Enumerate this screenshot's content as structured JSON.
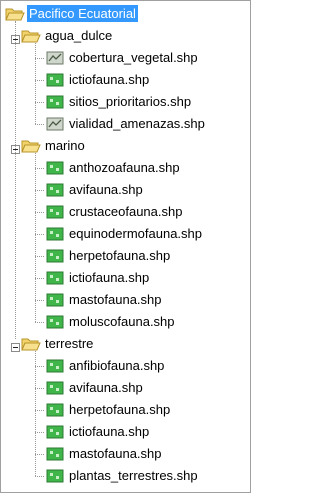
{
  "tree": {
    "root": {
      "label": "Pacifico Ecuatorial",
      "icon": "open-folder-icon",
      "selected": true
    },
    "groups": [
      {
        "name": "agua-dulce",
        "label": "agua_dulce",
        "expand_symbol": "−",
        "items": [
          {
            "label": "cobertura_vegetal.shp",
            "icon": "polyline-layer-icon"
          },
          {
            "label": "ictiofauna.shp",
            "icon": "polygon-layer-icon"
          },
          {
            "label": "sitios_prioritarios.shp",
            "icon": "polygon-layer-icon"
          },
          {
            "label": "vialidad_amenazas.shp",
            "icon": "polyline-layer-icon"
          }
        ]
      },
      {
        "name": "marino",
        "label": "marino",
        "expand_symbol": "−",
        "items": [
          {
            "label": "anthozoafauna.shp",
            "icon": "polygon-layer-icon"
          },
          {
            "label": "avifauna.shp",
            "icon": "polygon-layer-icon"
          },
          {
            "label": "crustaceofauna.shp",
            "icon": "polygon-layer-icon"
          },
          {
            "label": "equinodermofauna.shp",
            "icon": "polygon-layer-icon"
          },
          {
            "label": "herpetofauna.shp",
            "icon": "polygon-layer-icon"
          },
          {
            "label": "ictiofauna.shp",
            "icon": "polygon-layer-icon"
          },
          {
            "label": "mastofauna.shp",
            "icon": "polygon-layer-icon"
          },
          {
            "label": "moluscofauna.shp",
            "icon": "polygon-layer-icon"
          }
        ]
      },
      {
        "name": "terrestre",
        "label": "terrestre",
        "expand_symbol": "−",
        "items": [
          {
            "label": "anfibiofauna.shp",
            "icon": "polygon-layer-icon"
          },
          {
            "label": "avifauna.shp",
            "icon": "polygon-layer-icon"
          },
          {
            "label": "herpetofauna.shp",
            "icon": "polygon-layer-icon"
          },
          {
            "label": "ictiofauna.shp",
            "icon": "polygon-layer-icon"
          },
          {
            "label": "mastofauna.shp",
            "icon": "polygon-layer-icon"
          },
          {
            "label": "plantas_terrestres.shp",
            "icon": "polygon-layer-icon"
          }
        ]
      }
    ]
  },
  "colors": {
    "selection": "#3399ff",
    "folder": "#f2d36b",
    "folder_edge": "#b8952a",
    "layer_green": "#3fb54a",
    "polyline_gray": "#cfd6cc"
  }
}
